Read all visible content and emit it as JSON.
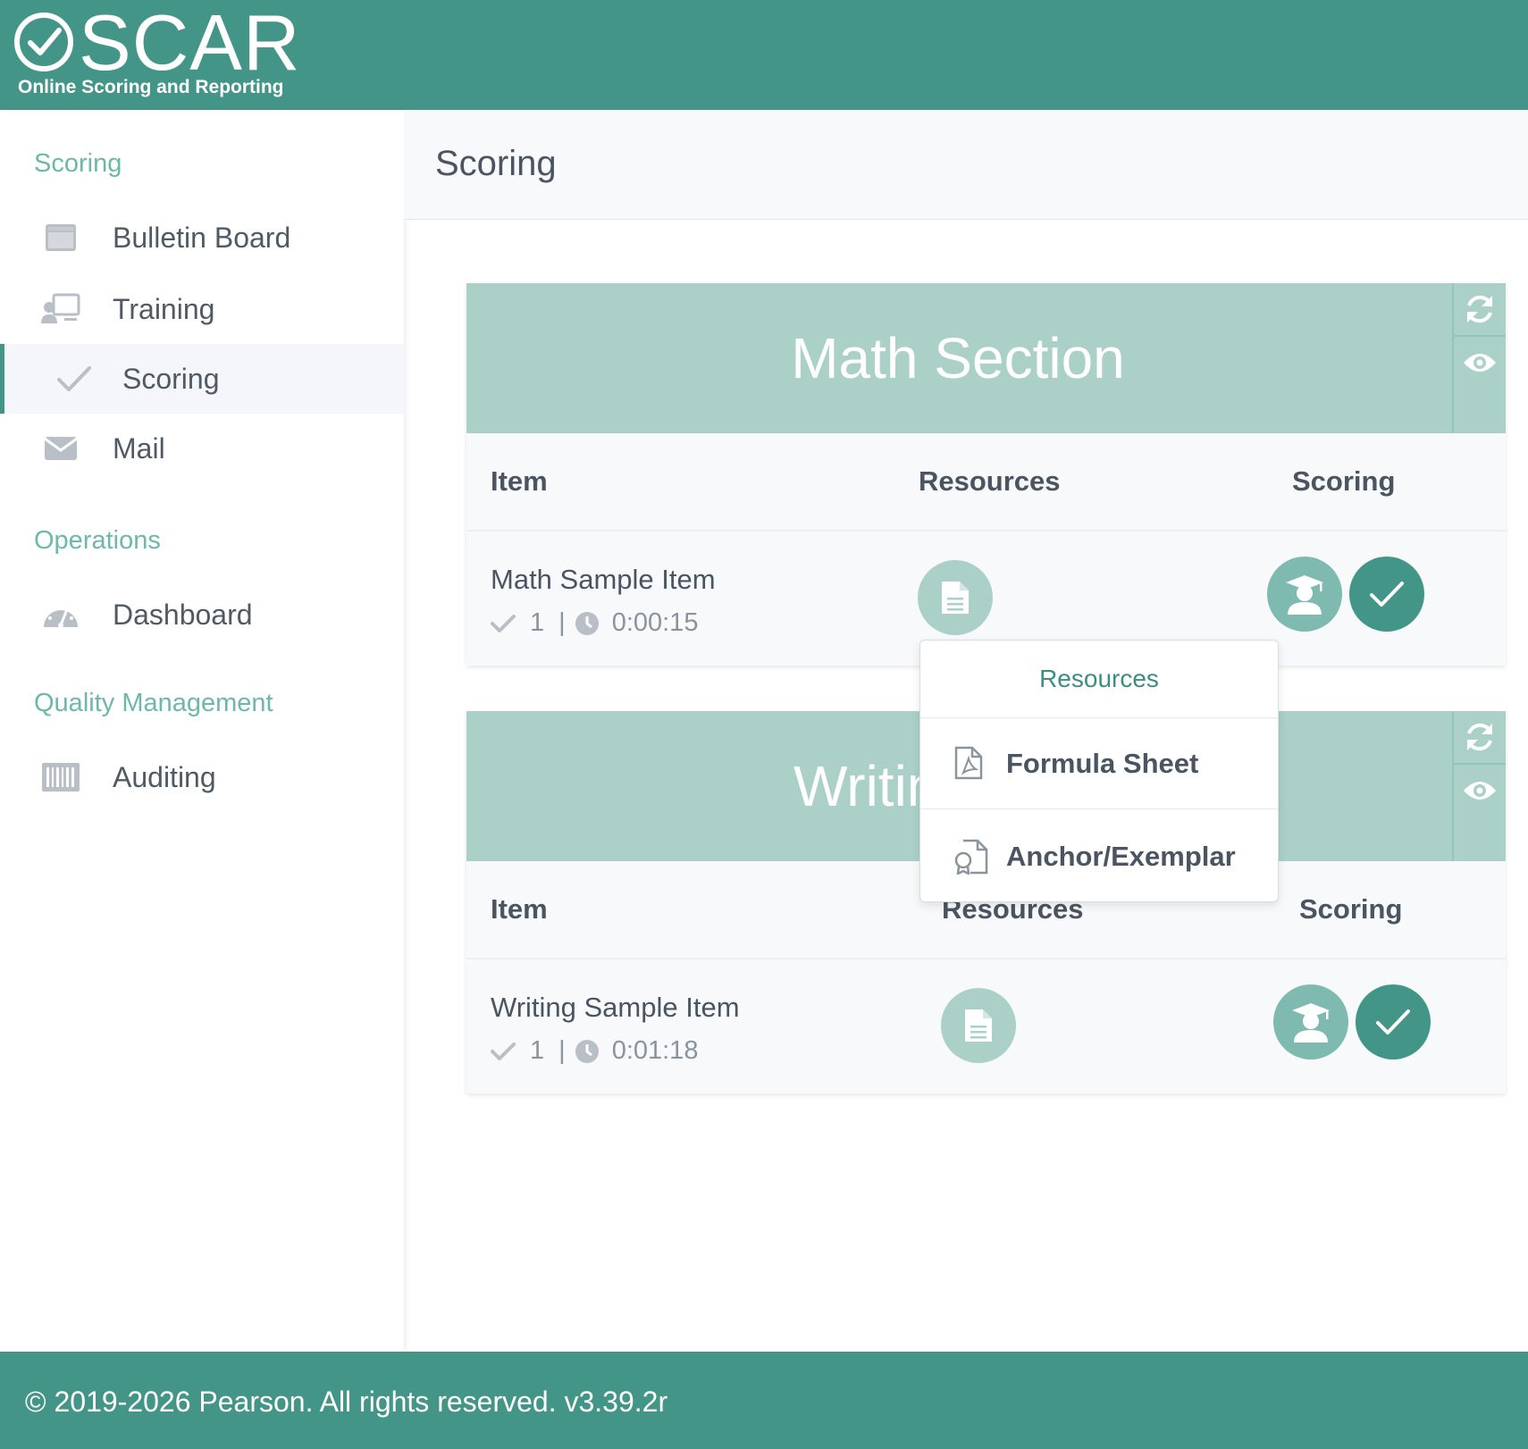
{
  "header": {
    "logo_word": "SCAR",
    "logo_subtitle": "Online Scoring and Reporting"
  },
  "sidebar": {
    "sections": [
      {
        "label": "Scoring"
      },
      {
        "label": "Operations"
      },
      {
        "label": "Quality Management"
      }
    ],
    "items": [
      {
        "label": "Bulletin Board",
        "icon": "calendar-icon"
      },
      {
        "label": "Training",
        "icon": "presentation-icon"
      },
      {
        "label": "Scoring",
        "icon": "check-icon",
        "active": true
      },
      {
        "label": "Mail",
        "icon": "envelope-icon"
      },
      {
        "label": "Dashboard",
        "icon": "gauge-icon"
      },
      {
        "label": "Auditing",
        "icon": "barcode-icon"
      }
    ]
  },
  "page": {
    "title": "Scoring"
  },
  "sections": [
    {
      "title": "Math Section",
      "columns": {
        "item": "Item",
        "resources": "Resources",
        "scoring": "Scoring"
      },
      "rows": [
        {
          "name": "Math Sample Item",
          "count": "1",
          "separator": "|",
          "time": "0:00:15"
        }
      ]
    },
    {
      "title": "Writin",
      "columns": {
        "item": "Item",
        "resources": "Resources",
        "scoring": "Scoring"
      },
      "rows": [
        {
          "name": "Writing Sample Item",
          "count": "1",
          "separator": "|",
          "time": "0:01:18"
        }
      ]
    }
  ],
  "resources_dropdown": {
    "header": "Resources",
    "items": [
      {
        "label": "Formula Sheet",
        "icon": "pdf-file-icon"
      },
      {
        "label": "Anchor/Exemplar",
        "icon": "certificate-file-icon"
      }
    ]
  },
  "footer": {
    "text": "© 2019-2026 Pearson. All rights reserved. v3.39.2r"
  },
  "colors": {
    "brand": "#439687",
    "section_header": "#abd0c8",
    "section_label": "#6db8a9"
  }
}
